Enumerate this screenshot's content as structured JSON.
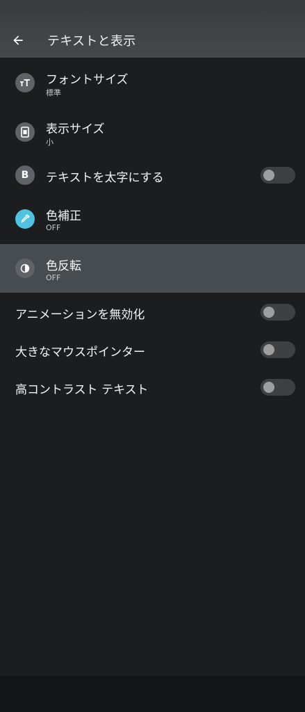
{
  "appbar": {
    "title": "テキストと表示",
    "back_icon": "arrow-left-icon"
  },
  "items": [
    {
      "title": "フォントサイズ",
      "subtitle": "標準",
      "icon": "font-size-icon"
    },
    {
      "title": "表示サイズ",
      "subtitle": "小",
      "icon": "display-size-icon"
    },
    {
      "title": "テキストを太字にする",
      "icon": "bold-icon",
      "toggle": false
    },
    {
      "title": "色補正",
      "subtitle": "OFF",
      "icon": "eyedropper-icon"
    },
    {
      "title": "色反転",
      "subtitle": "OFF",
      "icon": "color-inversion-icon",
      "selected": true
    },
    {
      "title": "アニメーションを無効化",
      "toggle": false
    },
    {
      "title": "大きなマウスポインター",
      "toggle": false
    },
    {
      "title": "高コントラスト テキスト",
      "toggle": false
    }
  ],
  "colors": {
    "background": "#1c1d1f",
    "appbar": "#474849",
    "selected_row": "#474c50",
    "icon_bg": "#5f6368",
    "accent_cyan": "#4fc3e0"
  }
}
